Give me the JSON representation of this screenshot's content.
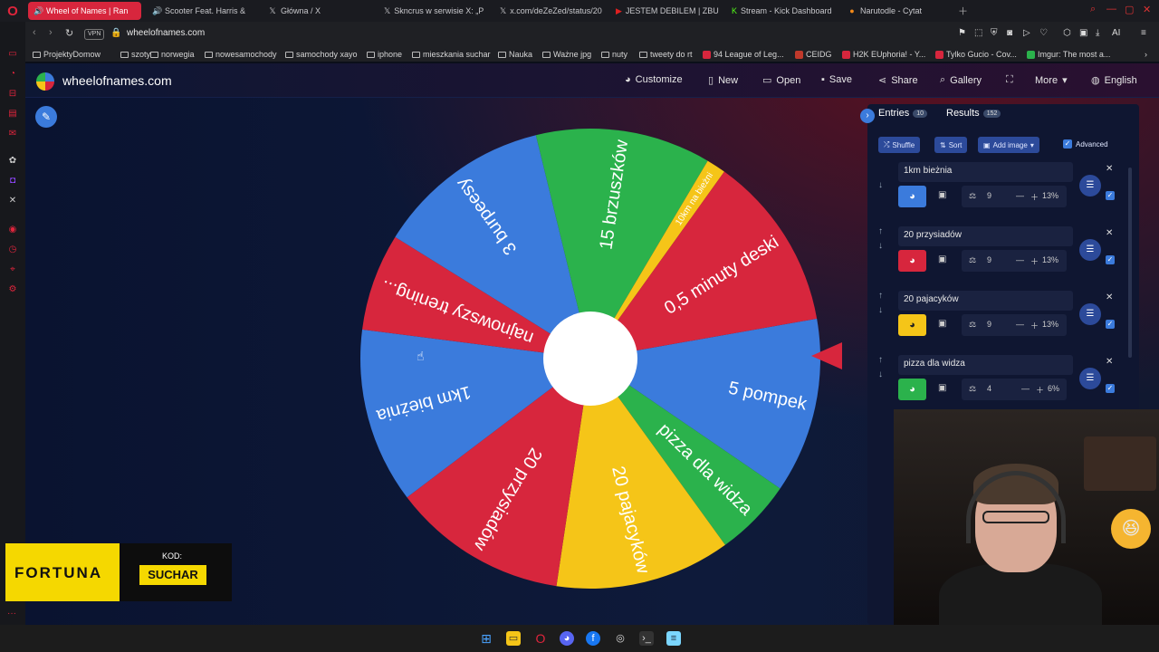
{
  "tabs": [
    {
      "label": "Wheel of Names | Ran",
      "active": true,
      "icon": "audio-icon"
    },
    {
      "label": "Scooter Feat. Harris &",
      "icon": "audio-icon"
    },
    {
      "label": "Główna / X",
      "icon": "x-logo-icon"
    },
    {
      "label": "Skncrus w serwisie X: „P",
      "icon": "x-logo-icon"
    },
    {
      "label": "x.com/deZeZed/status/20",
      "icon": "x-logo-icon"
    },
    {
      "label": "JESTEM DEBILEM | ZBUD",
      "icon": "youtube-icon"
    },
    {
      "label": "Stream - Kick Dashboard",
      "icon": "kick-icon"
    },
    {
      "label": "Narutodle - Cytat",
      "icon": "narutodle-icon"
    }
  ],
  "address": {
    "url": "wheelofnames.com",
    "vpn_label": "VPN"
  },
  "bookmarks": [
    {
      "label": "ProjektyDomow",
      "type": "folder"
    },
    {
      "label": "szoty",
      "type": "folder"
    },
    {
      "label": "norwegia",
      "type": "folder"
    },
    {
      "label": "nowesamochody",
      "type": "folder"
    },
    {
      "label": "samochody xayo",
      "type": "folder"
    },
    {
      "label": "iphone",
      "type": "folder"
    },
    {
      "label": "mieszkania suchar",
      "type": "folder"
    },
    {
      "label": "Nauka",
      "type": "folder"
    },
    {
      "label": "Ważne jpg",
      "type": "folder"
    },
    {
      "label": "nuty",
      "type": "folder"
    },
    {
      "label": "tweety do rt",
      "type": "folder"
    },
    {
      "label": "94 League of Leg...",
      "type": "site",
      "color": "#d7263d"
    },
    {
      "label": "CEIDG",
      "type": "site",
      "color": "#c0392b"
    },
    {
      "label": "H2K EUphoria! - Y...",
      "type": "site",
      "color": "#d7263d"
    },
    {
      "label": "Tylko Gucio - Cov...",
      "type": "site",
      "color": "#d7263d"
    },
    {
      "label": "Imgur: The most a...",
      "type": "site",
      "color": "#2bb24c"
    }
  ],
  "site": {
    "title": "wheelofnames.com",
    "menu": [
      "Customize",
      "New",
      "Open",
      "Save",
      "Share",
      "Gallery",
      "More",
      "English"
    ]
  },
  "wheel": {
    "segments": [
      {
        "label": "5 pompek",
        "color": "#3b7bdc",
        "weight": 9
      },
      {
        "label": "pizza dla widza",
        "color": "#2bb24c",
        "weight": 4
      },
      {
        "label": "20 pajacyków",
        "color": "#f5c518",
        "weight": 9
      },
      {
        "label": "20 przysiadów",
        "color": "#d7263d",
        "weight": 9
      },
      {
        "label": "1km bieżnia",
        "color": "#3b7bdc",
        "weight": 9
      },
      {
        "label": "najnowszy trening...",
        "color": "#d7263d",
        "weight": 5
      },
      {
        "label": "3 burpeesy",
        "color": "#3b7bdc",
        "weight": 9
      },
      {
        "label": "15 brzuszków",
        "color": "#2bb24c",
        "weight": 9
      },
      {
        "label": "10km na bieżni",
        "color": "#f5c518",
        "weight": 1
      },
      {
        "label": "0,5 minuty deski",
        "color": "#d7263d",
        "weight": 9
      }
    ]
  },
  "panel": {
    "entries_tab": "Entries",
    "entries_count": "10",
    "results_tab": "Results",
    "results_count": "152",
    "buttons": [
      "Shuffle",
      "Sort",
      "Add image"
    ],
    "advanced": "Advanced",
    "entries": [
      {
        "name": "1km bieżnia",
        "color": "#3b7bdc",
        "weight": "9",
        "percent": "13%"
      },
      {
        "name": "20 przysiadów",
        "color": "#d7263d",
        "weight": "9",
        "percent": "13%"
      },
      {
        "name": "20 pajacyków",
        "color": "#f5c518",
        "weight": "9",
        "percent": "13%"
      },
      {
        "name": "pizza dla widza",
        "color": "#2bb24c",
        "weight": "4",
        "percent": "6%"
      }
    ]
  },
  "sponsor": {
    "brand": "FORTUNA",
    "code_label": "KOD:",
    "code": "SUCHAR"
  }
}
